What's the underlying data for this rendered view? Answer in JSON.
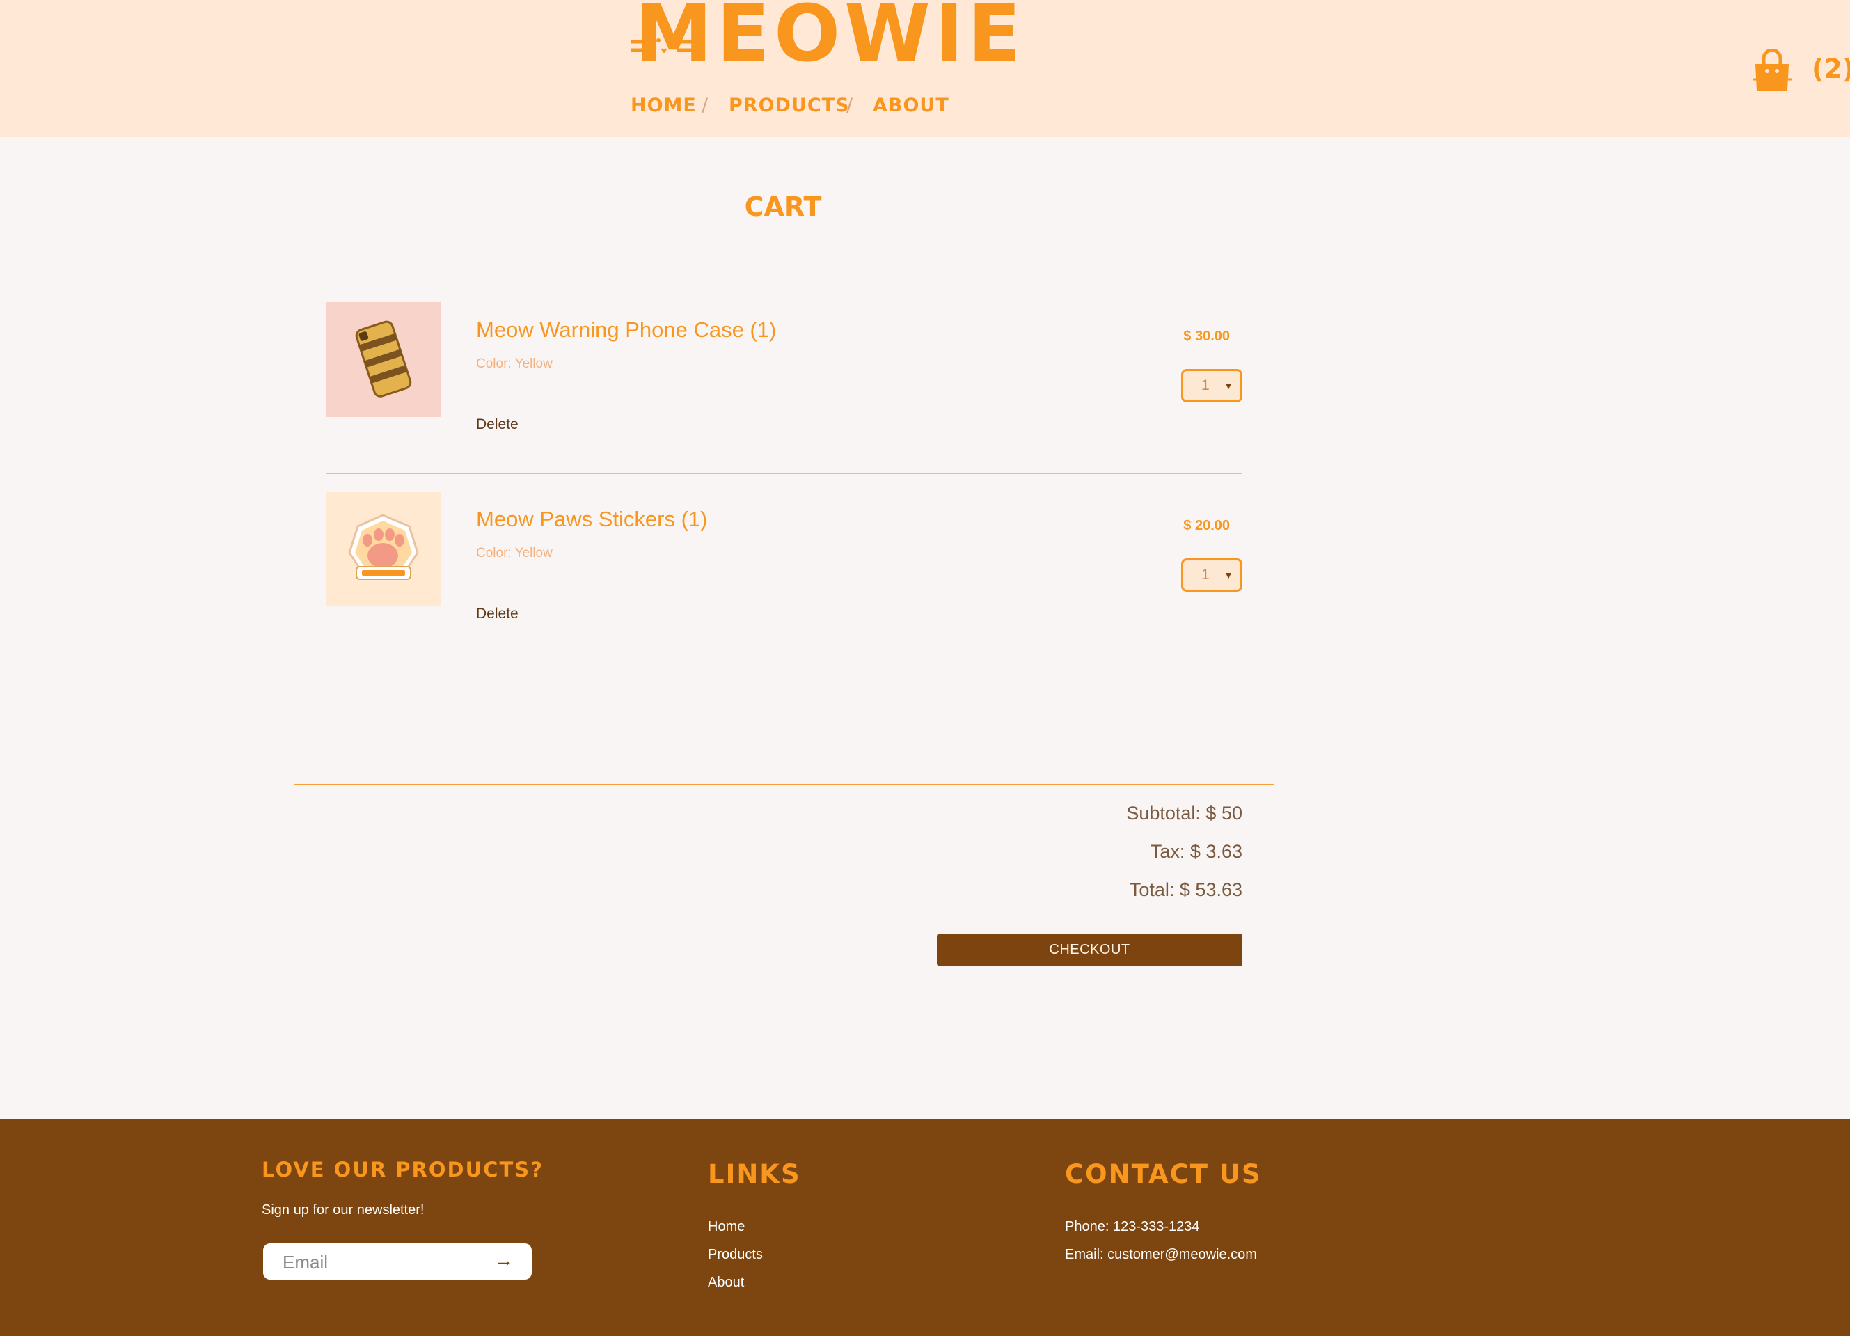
{
  "header": {
    "logo": "MEOWIE",
    "nav": {
      "home": "HOME",
      "products": "PRODUCTS",
      "about": "ABOUT",
      "separator": "/"
    },
    "cart_count": "(2)"
  },
  "cart": {
    "title": "CART",
    "items": [
      {
        "name": "Meow Warning Phone Case (1)",
        "color": "Color: Yellow",
        "price": "$ 30.00",
        "quantity": "1",
        "delete_label": "Delete",
        "image_icon": "phone-case-image"
      },
      {
        "name": "Meow Paws Stickers (1)",
        "color": "Color: Yellow",
        "price": "$ 20.00",
        "quantity": "1",
        "delete_label": "Delete",
        "image_icon": "paw-sticker-image"
      }
    ],
    "subtotal": "Subtotal: $ 50",
    "tax": "Tax: $ 3.63",
    "total": "Total: $ 53.63",
    "checkout_label": "CHECKOUT"
  },
  "footer": {
    "newsletter": {
      "heading": "LOVE OUR PRODUCTS?",
      "text": "Sign up for our newsletter!",
      "email_placeholder": "Email",
      "submit_icon": "→"
    },
    "links": {
      "heading": "LINKS",
      "home": "Home",
      "products": "Products",
      "about": "About"
    },
    "contact": {
      "heading": "CONTACT US",
      "phone": "Phone: 123-333-1234",
      "email": "Email: customer@meowie.com"
    }
  },
  "colors": {
    "header_bg": "#ffe8d6",
    "page_bg": "#f9f5f4",
    "accent_orange": "#f8961e",
    "footer_brown": "#7d4510"
  }
}
